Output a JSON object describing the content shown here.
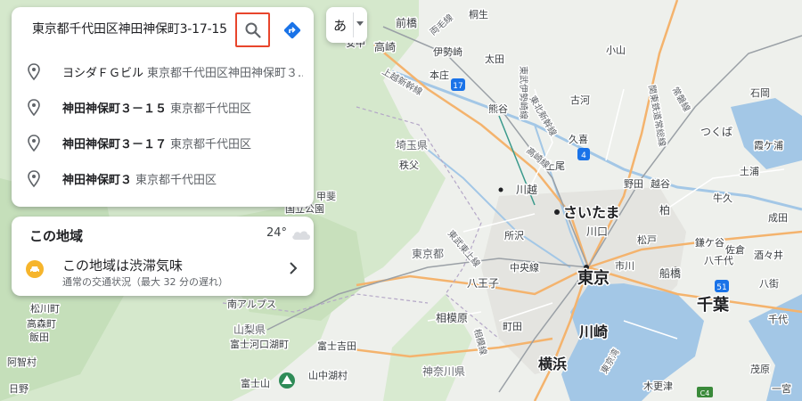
{
  "search": {
    "query": "東京都千代田区神田神保町3-17-15",
    "suggestions": [
      {
        "name": "ヨシダＦＧビル",
        "address": "東京都千代田区神田神保町３..."
      },
      {
        "name": "神田神保町３－１５",
        "address": "東京都千代田区"
      },
      {
        "name": "神田神保町３－１７",
        "address": "東京都千代田区"
      },
      {
        "name": "神田神保町３",
        "address": "東京都千代田区"
      }
    ]
  },
  "ime": {
    "label": "あ"
  },
  "area": {
    "title": "この地域",
    "temperature": "24°",
    "weather_icon": "cloud-icon",
    "traffic_title": "この地域は渋滞気味",
    "traffic_detail": "通常の交通状況（最大 32 分の遅れ）"
  },
  "map_labels": {
    "cities": [
      "前橋",
      "高崎",
      "伊勢崎",
      "太田",
      "本庄",
      "熊谷",
      "久喜",
      "つくば",
      "川越",
      "さいたま",
      "柏",
      "所沢",
      "川口",
      "松戸",
      "東京都",
      "中央線",
      "八王子",
      "東京",
      "市川",
      "船橋",
      "千葉",
      "相模原",
      "町田",
      "川崎",
      "横浜",
      "神奈川県",
      "山梨県",
      "富士河口湖町",
      "富士吉田",
      "山中湖村",
      "富士山",
      "南アルプス",
      "松川町",
      "高森町",
      "飯田",
      "阿智村",
      "日野",
      "秩父",
      "埼玉県",
      "桐生",
      "小山",
      "古河",
      "石岡",
      "土浦",
      "霞ケ浦",
      "牛久",
      "成田",
      "酒々井",
      "佐倉",
      "八街",
      "木更津",
      "茂原",
      "一宮",
      "野田",
      "上尾",
      "越谷",
      "鎌ケ谷",
      "八千代",
      "千代",
      "安中",
      "甲斐",
      "国立公園"
    ],
    "rail": [
      "両毛線",
      "上越新幹線",
      "東武伊勢崎線",
      "東北新幹線",
      "高崎線",
      "東武東上線",
      "常磐線",
      "関東鉄道常総線",
      "相模線",
      "東京湾"
    ],
    "route_shields": [
      "17",
      "4",
      "51",
      "C4",
      "6"
    ]
  },
  "colors": {
    "accent_red": "#e8452c",
    "directions_blue": "#1a73e8",
    "traffic_yellow": "#f6b52c",
    "water": "#a3c7e6",
    "forest": "#cfe5c6"
  }
}
